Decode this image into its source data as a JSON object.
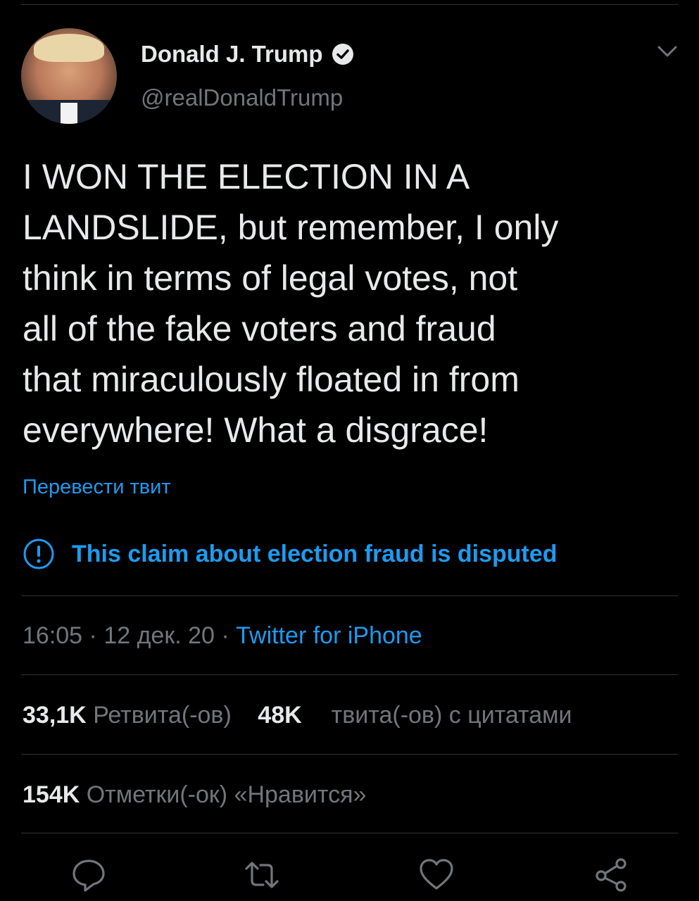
{
  "author": {
    "display_name": "Donald J. Trump",
    "handle": "@realDonaldTrump",
    "verified": true
  },
  "tweet": {
    "text": "I WON THE ELECTION IN A\nLANDSLIDE, but remember, I only\nthink in terms of legal votes, not\nall of the fake voters and fraud\nthat miraculously floated in from\neverywhere! What a disgrace!",
    "translate_label": "Перевести твит",
    "dispute_label": "This claim about election fraud is disputed"
  },
  "meta": {
    "time": "16:05",
    "separator": " · ",
    "date": "12 дек. 20",
    "source": "Twitter for iPhone"
  },
  "stats": {
    "retweets_count": "33,1K",
    "retweets_label": "Ретвита(-ов)",
    "quotes_count": "48K",
    "quotes_label": "твита(-ов) с цитатами",
    "likes_count": "154K",
    "likes_label": "Отметки(-ок) «Нравится»"
  },
  "icons": {
    "verified": "verified-badge-icon",
    "more": "chevron-down-icon",
    "dispute": "exclamation-circle-icon",
    "reply": "reply-icon",
    "retweet": "retweet-icon",
    "like": "heart-icon",
    "share": "share-icon"
  },
  "colors": {
    "background": "#000000",
    "text": "#e7e9ea",
    "secondary": "#71767b",
    "accent": "#1d9bf0",
    "divider": "#2f3336"
  }
}
